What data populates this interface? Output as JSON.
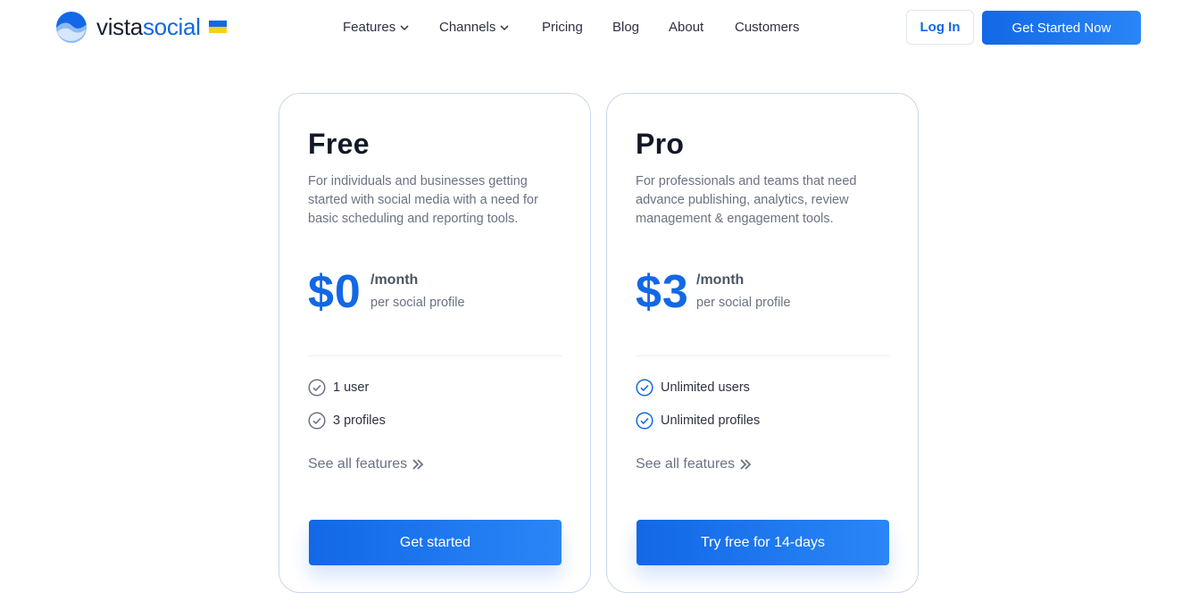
{
  "brand": {
    "name_part1": "vista",
    "name_part2": "social"
  },
  "nav": {
    "items": [
      {
        "label": "Features",
        "dropdown": true
      },
      {
        "label": "Channels",
        "dropdown": true
      },
      {
        "label": "Pricing",
        "dropdown": false
      },
      {
        "label": "Blog",
        "dropdown": false
      },
      {
        "label": "About",
        "dropdown": false
      },
      {
        "label": "Customers",
        "dropdown": false
      }
    ],
    "login_label": "Log In",
    "cta_label": "Get Started Now"
  },
  "plans": [
    {
      "name": "Free",
      "description": "For individuals and businesses getting started with social media with a need for basic scheduling and reporting tools.",
      "price": "$0",
      "period": "/month",
      "unit": "per social profile",
      "features": [
        "1 user",
        "3 profiles"
      ],
      "see_all": "See all features",
      "button": "Get started"
    },
    {
      "name": "Pro",
      "description": "For professionals and teams that need advance publishing, analytics, review management & engagement tools.",
      "price": "$3",
      "period": "/month",
      "unit": "per social profile",
      "features": [
        "Unlimited users",
        "Unlimited profiles"
      ],
      "see_all": "See all features",
      "button": "Try free for 14-days"
    }
  ],
  "colors": {
    "accent": "#1268e6",
    "free_check": "#6b7282",
    "pro_check": "#1268e6",
    "flag_blue": "#1268e6",
    "flag_yellow": "#f7d117"
  },
  "icons": [
    "chevron-down-icon",
    "check-circle-icon",
    "double-chevron-right-icon"
  ]
}
